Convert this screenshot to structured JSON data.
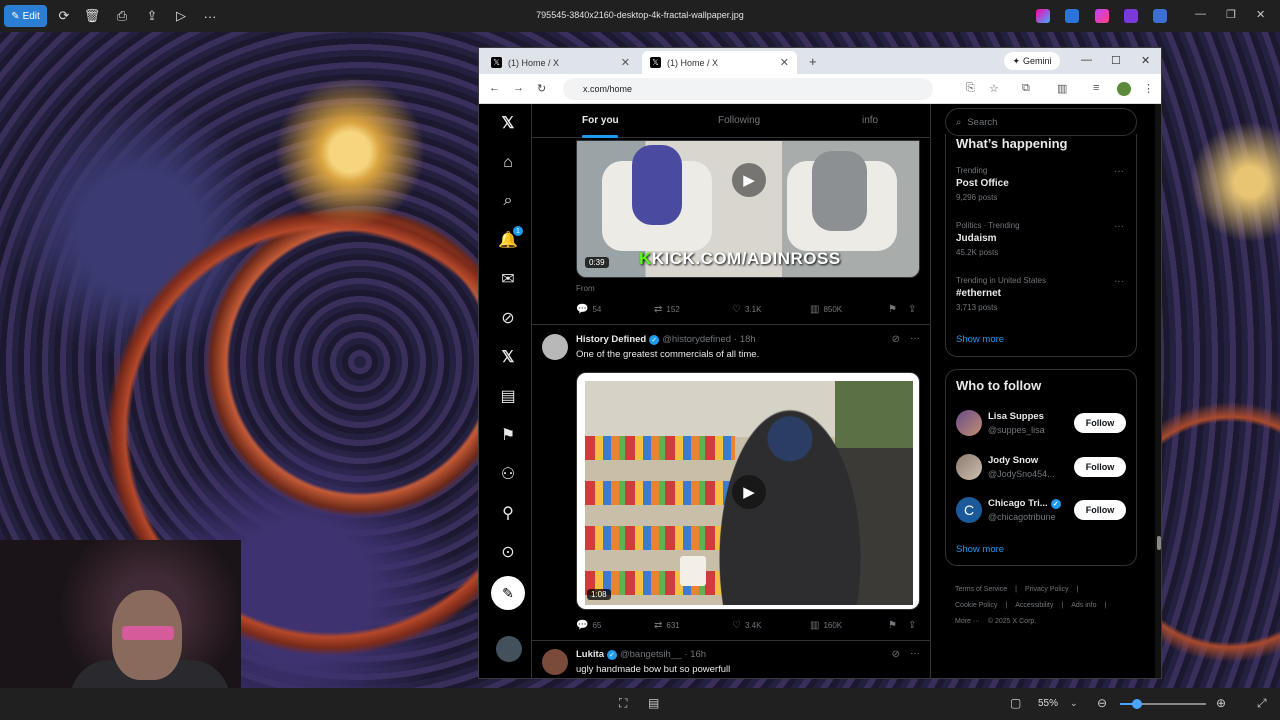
{
  "viewer": {
    "edit_label": "Edit",
    "file_title": "795545-3840x2160-desktop-4k-fractal-wallpaper.jpg",
    "zoom": "55%",
    "zoom_fraction": 0.2
  },
  "browser": {
    "tabs": [
      {
        "title": "(1) Home / X",
        "active": false
      },
      {
        "title": "(1) Home / X",
        "active": true
      }
    ],
    "gemini_label": "Gemini",
    "url": "x.com/home"
  },
  "nav": {
    "notification_count": "1",
    "icons": [
      "x-logo-icon",
      "home-icon",
      "search-icon",
      "notifications-icon",
      "messages-icon",
      "grok-icon",
      "x-premium-icon",
      "lists-icon",
      "bookmarks-icon",
      "communities-icon",
      "profile-icon",
      "more-icon"
    ]
  },
  "feed": {
    "tabs": [
      "For you",
      "Following",
      "info"
    ],
    "post1": {
      "duration": "0:39",
      "overlay_text": "KICK.COM/ADINROSS",
      "from": "From",
      "replies": "54",
      "reposts": "152",
      "likes": "3.1K",
      "views": "850K"
    },
    "post2": {
      "name": "History Defined",
      "handle": "@historydefined",
      "time": "· 18h",
      "text": "One of the greatest commercials of all time.",
      "duration": "1:08",
      "replies": "65",
      "reposts": "631",
      "likes": "3.4K",
      "views": "160K"
    },
    "post3": {
      "name": "Lukita",
      "handle": "@bangetsih__",
      "time": "· 16h",
      "text": "ugly handmade bow but so powerfull"
    }
  },
  "aside": {
    "search_placeholder": "Search",
    "trends_title": "What’s happening",
    "trends": [
      {
        "meta": "Trending",
        "name": "Post Office",
        "posts": "9,296 posts"
      },
      {
        "meta": "Politics · Trending",
        "name": "Judaism",
        "posts": "45.2K posts"
      },
      {
        "meta": "Trending in United States",
        "name": "#ethernet",
        "posts": "3,713 posts"
      }
    ],
    "trends_show_more": "Show more",
    "wtf_title": "Who to follow",
    "wtf": [
      {
        "name": "Lisa Suppes",
        "handle": "@suppes_lisa",
        "button": "Follow"
      },
      {
        "name": "Jody Snow",
        "handle": "@JodySno454...",
        "button": "Follow"
      },
      {
        "name": "Chicago Tri...",
        "handle": "@chicagotribune",
        "button": "Follow"
      }
    ],
    "wtf_show_more": "Show more",
    "footer": [
      "Terms of Service",
      "|",
      "Privacy Policy",
      "|",
      "Cookie Policy",
      "|",
      "Accessibility",
      "|",
      "Ads info",
      "|",
      "More ···",
      "© 2025 X Corp."
    ]
  },
  "colors": {
    "accent": "#1d9bf0",
    "viewer_accent": "#2a7fd4",
    "bg": "#000000"
  }
}
